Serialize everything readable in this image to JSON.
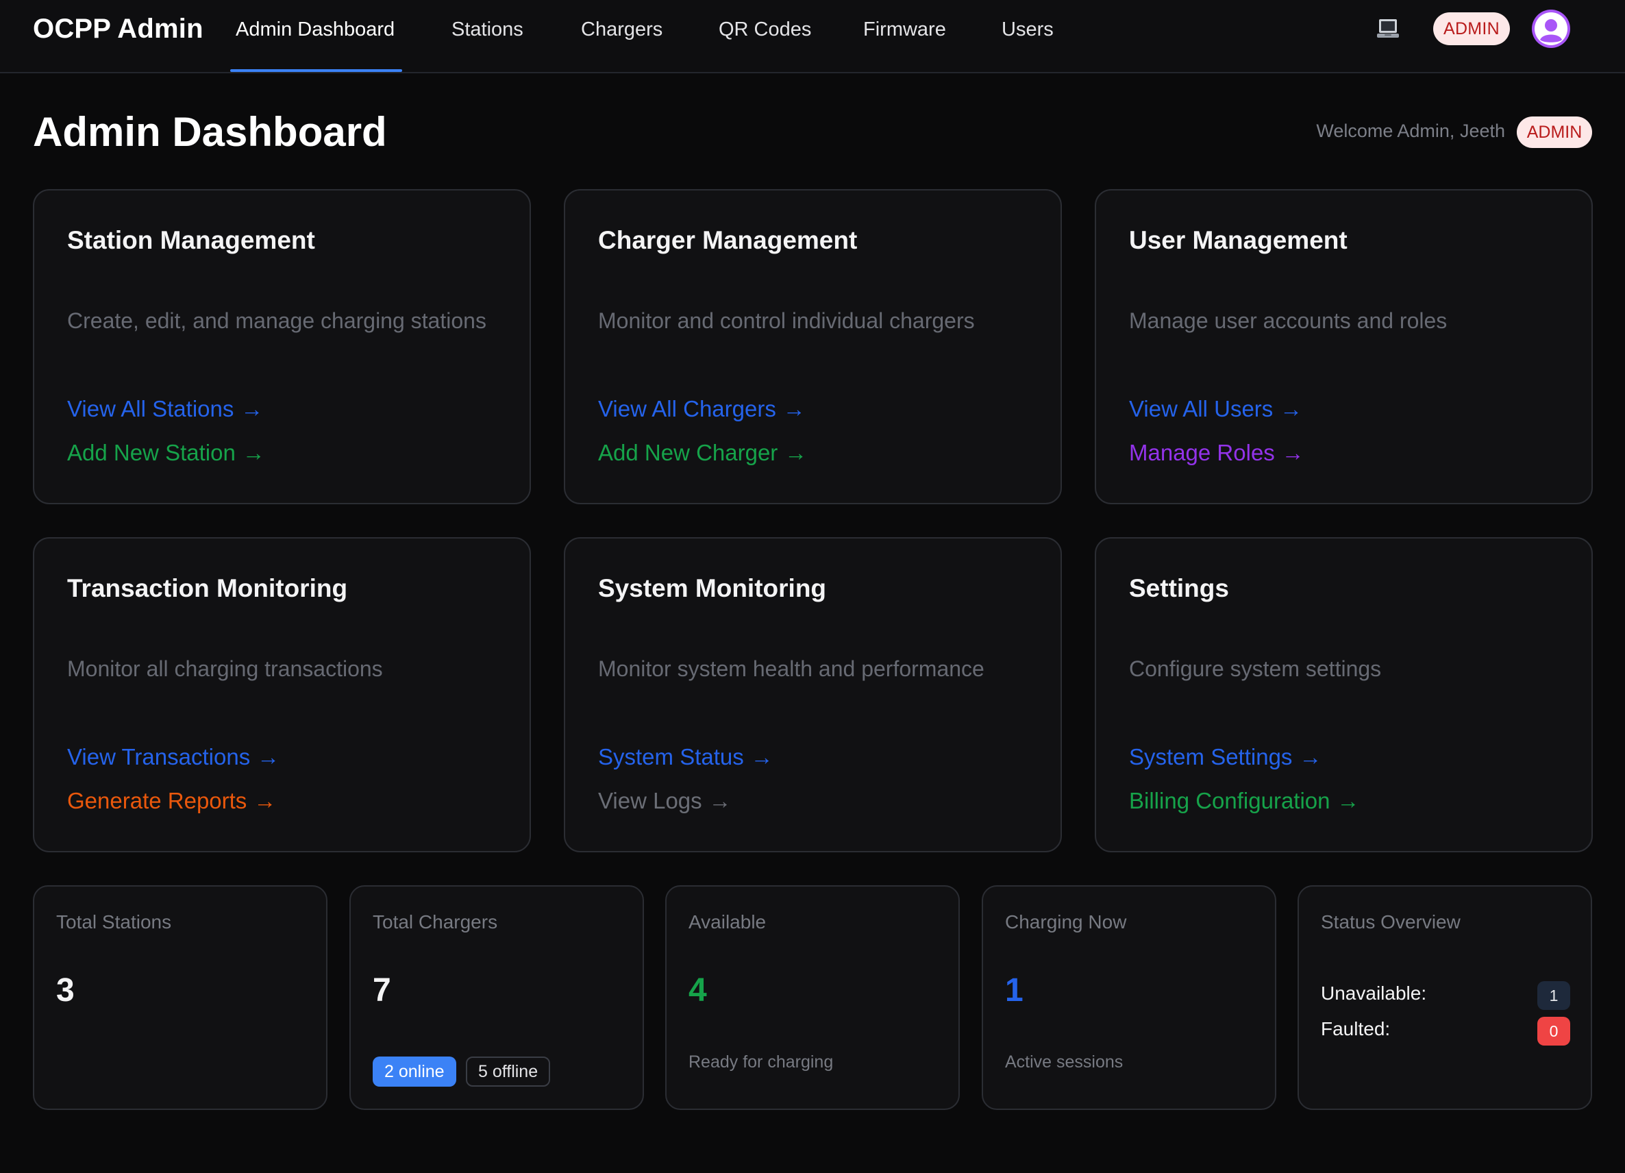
{
  "nav": {
    "brand": "OCPP Admin",
    "items": [
      {
        "label": "Admin Dashboard",
        "active": true
      },
      {
        "label": "Stations"
      },
      {
        "label": "Chargers"
      },
      {
        "label": "QR Codes"
      },
      {
        "label": "Firmware"
      },
      {
        "label": "Users"
      }
    ],
    "role_badge": "ADMIN",
    "icons": [
      "laptop-icon",
      "user-avatar-icon"
    ]
  },
  "header": {
    "title": "Admin Dashboard",
    "welcome": "Welcome Admin, Jeeth",
    "role_badge": "ADMIN"
  },
  "cards": [
    {
      "title": "Station Management",
      "desc": "Create, edit, and manage charging stations",
      "links": [
        {
          "label": "View All Stations",
          "color": "#2563eb"
        },
        {
          "label": "Add New Station",
          "color": "#16a34a"
        }
      ]
    },
    {
      "title": "Charger Management",
      "desc": "Monitor and control individual chargers",
      "links": [
        {
          "label": "View All Chargers",
          "color": "#2563eb"
        },
        {
          "label": "Add New Charger",
          "color": "#16a34a"
        }
      ]
    },
    {
      "title": "User Management",
      "desc": "Manage user accounts and roles",
      "links": [
        {
          "label": "View All Users",
          "color": "#2563eb"
        },
        {
          "label": "Manage Roles",
          "color": "#9333ea"
        }
      ]
    },
    {
      "title": "Transaction Monitoring",
      "desc": "Monitor all charging transactions",
      "links": [
        {
          "label": "View Transactions",
          "color": "#2563eb"
        },
        {
          "label": "Generate Reports",
          "color": "#ea580c"
        }
      ]
    },
    {
      "title": "System Monitoring",
      "desc": "Monitor system health and performance",
      "links": [
        {
          "label": "System Status",
          "color": "#2563eb"
        },
        {
          "label": "View Logs",
          "color": "#6b6e76"
        }
      ]
    },
    {
      "title": "Settings",
      "desc": "Configure system settings",
      "links": [
        {
          "label": "System Settings",
          "color": "#2563eb"
        },
        {
          "label": "Billing Configuration",
          "color": "#16a34a"
        }
      ]
    }
  ],
  "arrow": "→",
  "stats": {
    "total_stations": {
      "label": "Total Stations",
      "value": "3"
    },
    "total_chargers": {
      "label": "Total Chargers",
      "value": "7",
      "online": "2 online",
      "offline": "5 offline"
    },
    "available": {
      "label": "Available",
      "value": "4",
      "sub": "Ready for charging",
      "color": "#16a34a"
    },
    "charging_now": {
      "label": "Charging Now",
      "value": "1",
      "sub": "Active sessions",
      "color": "#2563eb"
    },
    "status_overview": {
      "label": "Status Overview",
      "unavailable_label": "Unavailable:",
      "unavailable_count": "1",
      "faulted_label": "Faulted:",
      "faulted_count": "0"
    }
  }
}
